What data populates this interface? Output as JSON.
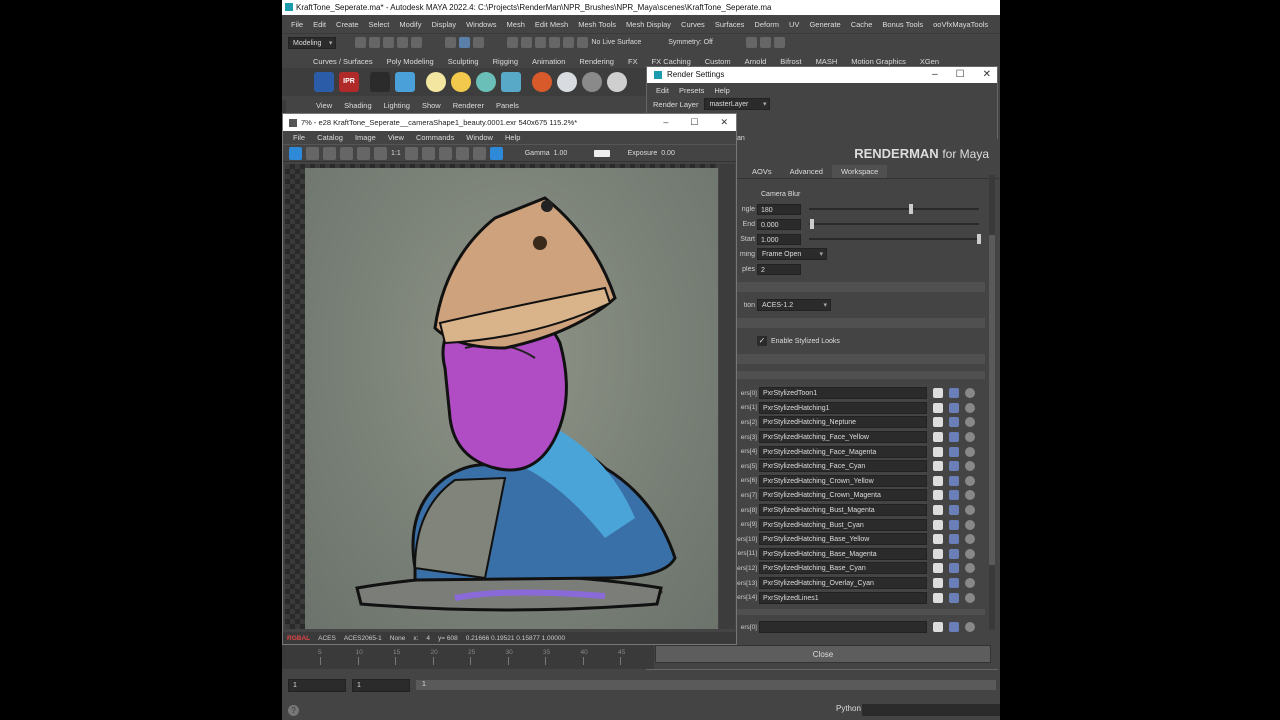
{
  "maya": {
    "title": "KraftTone_Seperate.ma* - Autodesk MAYA 2022.4: C:\\Projects\\RenderMan\\NPR_Brushes\\NPR_Maya\\scenes\\KraftTone_Seperate.ma",
    "menus": [
      "File",
      "Edit",
      "Create",
      "Select",
      "Modify",
      "Display",
      "Windows",
      "Mesh",
      "Edit Mesh",
      "Mesh Tools",
      "Mesh Display",
      "Curves",
      "Surfaces",
      "Deform",
      "UV",
      "Generate",
      "Cache",
      "Bonus Tools",
      "ooVfxMayaTools"
    ],
    "mode": "Modeling",
    "live_surface": "No Live Surface",
    "symmetry": "Symmetry: Off",
    "shelf_tabs": [
      "Curves / Surfaces",
      "Poly Modeling",
      "Sculpting",
      "Rigging",
      "Animation",
      "Rendering",
      "FX",
      "FX Caching",
      "Custom",
      "Arnold",
      "Bifrost",
      "MASH",
      "Motion Graphics",
      "XGen"
    ],
    "panel_menus": [
      "View",
      "Shading",
      "Lighting",
      "Show",
      "Renderer",
      "Panels"
    ],
    "shelf_ipr": "IPR",
    "timeline_ticks": [
      "5",
      "10",
      "15",
      "20",
      "25",
      "30",
      "35",
      "40",
      "45"
    ],
    "range_start": "1",
    "range_start2": "1",
    "range_bar_label": "1",
    "python_label": "Python"
  },
  "render_settings": {
    "title": "Render Settings",
    "menus": [
      "Edit",
      "Presets",
      "Help"
    ],
    "render_layer_label": "Render Layer",
    "render_layer_value": "masterLayer",
    "tab_partial": "an",
    "brand": "RENDERMAN",
    "brand_for": "for Maya",
    "tabs": [
      "AOVs",
      "Advanced",
      "Workspace"
    ],
    "camera_blur": "Camera Blur",
    "attrs": [
      {
        "label": "ngle",
        "value": "180",
        "knob": 0.6
      },
      {
        "label": "End",
        "value": "0.000",
        "knob": 0.02
      },
      {
        "label": "Start",
        "value": "1.000",
        "knob": 1.0
      }
    ],
    "timing_label": "ming",
    "timing_value": "Frame Open",
    "samples_label": "ples",
    "samples_value": "2",
    "ocio_label": "tion",
    "ocio_value": "ACES-1.2",
    "stylized_checkbox": "Enable Stylized Looks",
    "filters": [
      {
        "idx": "ers[0]",
        "name": "PxrStylizedToon1"
      },
      {
        "idx": "ers[1]",
        "name": "PxrStylizedHatching1"
      },
      {
        "idx": "ers[2]",
        "name": "PxrStylizedHatching_Neptune"
      },
      {
        "idx": "ers[3]",
        "name": "PxrStylizedHatching_Face_Yellow"
      },
      {
        "idx": "ers[4]",
        "name": "PxrStylizedHatching_Face_Magenta"
      },
      {
        "idx": "ers[5]",
        "name": "PxrStylizedHatching_Face_Cyan"
      },
      {
        "idx": "ers[6]",
        "name": "PxrStylizedHatching_Crown_Yellow"
      },
      {
        "idx": "ers[7]",
        "name": "PxrStylizedHatching_Crown_Magenta"
      },
      {
        "idx": "ers[8]",
        "name": "PxrStylizedHatching_Bust_Magenta"
      },
      {
        "idx": "ers[9]",
        "name": "PxrStylizedHatching_Bust_Cyan"
      },
      {
        "idx": "ers[10]",
        "name": "PxrStylizedHatching_Base_Yellow"
      },
      {
        "idx": "ers[11]",
        "name": "PxrStylizedHatching_Base_Magenta"
      },
      {
        "idx": "ers[12]",
        "name": "PxrStylizedHatching_Base_Cyan"
      },
      {
        "idx": "ers[13]",
        "name": "PxrStylizedHatching_Overlay_Cyan"
      },
      {
        "idx": "ers[14]",
        "name": "PxrStylizedLines1"
      }
    ],
    "extra_idx": "ers[0]",
    "close_label": "Close"
  },
  "image_viewer": {
    "title": "7% - e28 KraftTone_Seperate__cameraShape1_beauty.0001.exr 540x675 115.2%*",
    "menus": [
      "File",
      "Catalog",
      "Image",
      "View",
      "Commands",
      "Window",
      "Help"
    ],
    "ratio_label": "1:1",
    "gamma_label": "Gamma",
    "gamma_value": "1.00",
    "exposure_label": "Exposure",
    "exposure_value": "0.00",
    "status": {
      "channels": "RGBAL",
      "aces": "ACES",
      "aces_mode": "ACES2065-1",
      "none": "None",
      "x": "x:",
      "x_value": "4",
      "y": "y= 608",
      "pixel": "0.21666 0.19521 0.15877 1.00000"
    }
  },
  "colors": {
    "accent": "#2e8ad8",
    "face_magenta": "#c04fc8",
    "bust_cyan": "#3f87c8",
    "crown_peach": "#d4a878"
  }
}
